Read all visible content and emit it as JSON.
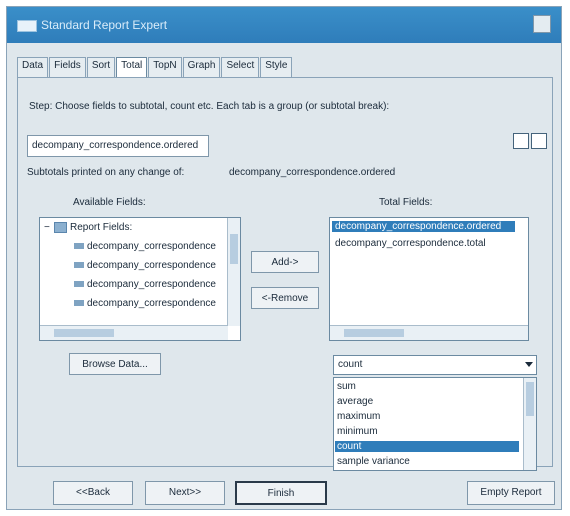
{
  "window": {
    "title": "Standard Report Expert"
  },
  "tabs": [
    "Data",
    "Fields",
    "Sort",
    "Total",
    "TopN",
    "Graph",
    "Select",
    "Style"
  ],
  "active_tab": "Total",
  "step_text": "Step:  Choose fields to subtotal, count etc.  Each tab is a group (or subtotal break):",
  "sort_field": "decompany_correspondence.ordered",
  "subtotal_line": {
    "label": "Subtotals printed on any change of:",
    "value": "decompany_correspondence.ordered"
  },
  "available_fields": {
    "label": "Available Fields:",
    "root": "Report Fields:",
    "items": [
      "decompany_correspondence",
      "decompany_correspondence",
      "decompany_correspondence",
      "decompany_correspondence"
    ]
  },
  "buttons": {
    "add": "Add->",
    "remove": "<-Remove",
    "browse": "Browse Data..."
  },
  "total_fields": {
    "label": "Total Fields:",
    "items": [
      "decompany_correspondence.ordered",
      "decompany_correspondence.total"
    ],
    "selected_index": 0
  },
  "summary_type": {
    "value": "count",
    "options": [
      "sum",
      "average",
      "maximum",
      "minimum",
      "count",
      "sample variance"
    ],
    "highlighted_index": 4
  },
  "footer": {
    "back": "<<Back",
    "next": "Next>>",
    "finish": "Finish",
    "empty": "Empty Report"
  },
  "colors": {
    "title_bar": "#2f7dba",
    "selection": "#2f7dba",
    "panel_background": "#dfe7ec"
  }
}
